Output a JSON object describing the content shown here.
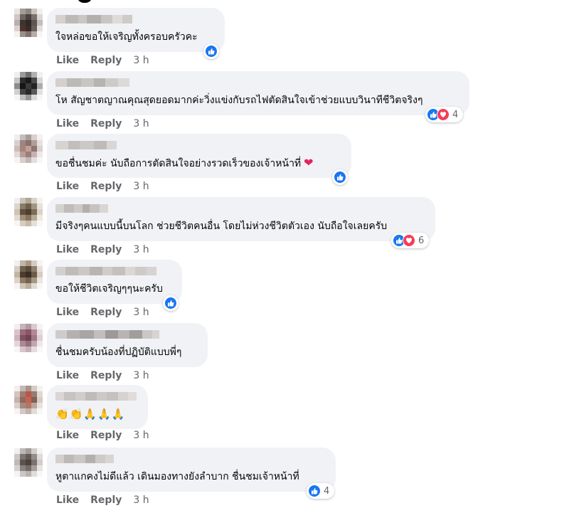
{
  "actions": {
    "like": "Like",
    "reply": "Reply"
  },
  "colors": {
    "like_blue": "#1877f2",
    "love_red": "#f33e58",
    "bubble": "#f0f2f5",
    "meta": "#65676b"
  },
  "comments": [
    {
      "text": "ใจหล่อขอให้เจริญทั้งครอบครัวคะ",
      "time": "3 h",
      "reactions": [
        "like"
      ],
      "count": ""
    },
    {
      "text": "โห สัญชาตญาณคุณสุดยอดมากค่ะวิ่งแข่งกับรถไฟตัดสินใจเข้าช่วยแบบวินาทีชีวิตจริงๆ",
      "time": "3 h",
      "reactions": [
        "like",
        "love"
      ],
      "count": "4"
    },
    {
      "text": "ขอชื่นชมค่ะ นับถือการตัดสินใจอย่างรวดเร็วของเจ้าหน้าที่",
      "time": "3 h",
      "reactions": [
        "like"
      ],
      "count": "",
      "emoji": "heart-emoji"
    },
    {
      "text": "มีจริงๆคนแบบนี้บนโลก ช่วยชีวิตคนอื่น โดยไม่ห่วงชีวิตตัวเอง นับถือใจเลยครับ",
      "time": "3 h",
      "reactions": [
        "like",
        "love"
      ],
      "count": "6"
    },
    {
      "text": "ขอให้ชีวิตเจริญๆๆนะครับ",
      "time": "3 h",
      "reactions": [
        "like"
      ],
      "count": ""
    },
    {
      "text": "ชื่นชมครับน้องที่ปฏิบัติแบบพี่ๆ",
      "time": "3 h",
      "reactions": [],
      "count": ""
    },
    {
      "text": "👏👏🙏🙏🙏",
      "time": "3 h",
      "reactions": [],
      "count": ""
    },
    {
      "text": "หูตาแกคงไม่ดีแล้ว เดินมองทางยังลำบาก ชื่นชมเจ้าหน้าที่",
      "time": "3 h",
      "reactions": [
        "like"
      ],
      "count": "4"
    }
  ]
}
